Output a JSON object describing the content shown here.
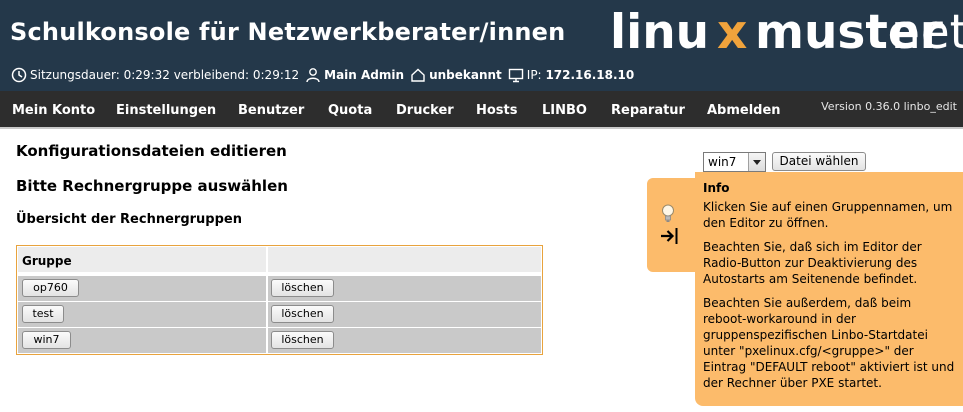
{
  "app": {
    "title": "Schulkonsole für Netzwerkberater/innen"
  },
  "logo": {
    "part1": "linu",
    "part2": "x",
    "part3": "muster",
    "part4": ".net"
  },
  "status": {
    "session_label": "Sitzungsdauer:",
    "session_value": "0:29:32",
    "remaining_label": "verbleibend:",
    "remaining_value": "0:29:12",
    "user": "Main Admin",
    "room": "unbekannt",
    "ip_label": "IP:",
    "ip_value": "172.16.18.10"
  },
  "menu": [
    "Mein Konto",
    "Einstellungen",
    "Benutzer",
    "Quota",
    "Drucker",
    "Hosts",
    "LINBO",
    "Reparatur",
    "Abmelden"
  ],
  "version": "Version 0.36.0 linbo_edit",
  "main": {
    "heading": "Konfigurationsdateien editieren",
    "subheading": "Bitte Rechnergruppe auswählen",
    "section_title": "Übersicht der Rechnergruppen",
    "table": {
      "header": "Gruppe",
      "rows": [
        {
          "name": "op760",
          "action": "löschen"
        },
        {
          "name": "test",
          "action": "löschen"
        },
        {
          "name": "win7",
          "action": "löschen"
        }
      ]
    }
  },
  "file_select": {
    "selected": "win7",
    "button": "Datei wählen"
  },
  "info": {
    "title": "Info",
    "paragraphs": [
      "Klicken Sie auf einen Gruppennamen, um den Editor zu öffnen.",
      "Beachten Sie, daß sich im Editor der Radio-Button zur Deaktivierung des Autostarts am Seitenende befindet.",
      "Beachten Sie außerdem, daß beim reboot-workaround in der gruppenspezifischen Linbo-Startdatei unter \"pxelinux.cfg/<gruppe>\" der Eintrag \"DEFAULT reboot\" aktiviert ist und der Rechner über PXE startet."
    ]
  },
  "icons": {
    "session": "clock-icon",
    "user": "user-icon",
    "room": "house-icon",
    "ip": "monitor-icon",
    "info_hint": "lightbulb-icon",
    "info_collapse": "arrow-right-bar-icon"
  },
  "colors": {
    "header_bg": "#24384a",
    "menu_bg": "#2d2d2d",
    "logo_accent": "#f0a33c",
    "info_bg": "#fcbb6b",
    "table_border": "#e8a33d",
    "table_cell": "#c9c9c9"
  }
}
